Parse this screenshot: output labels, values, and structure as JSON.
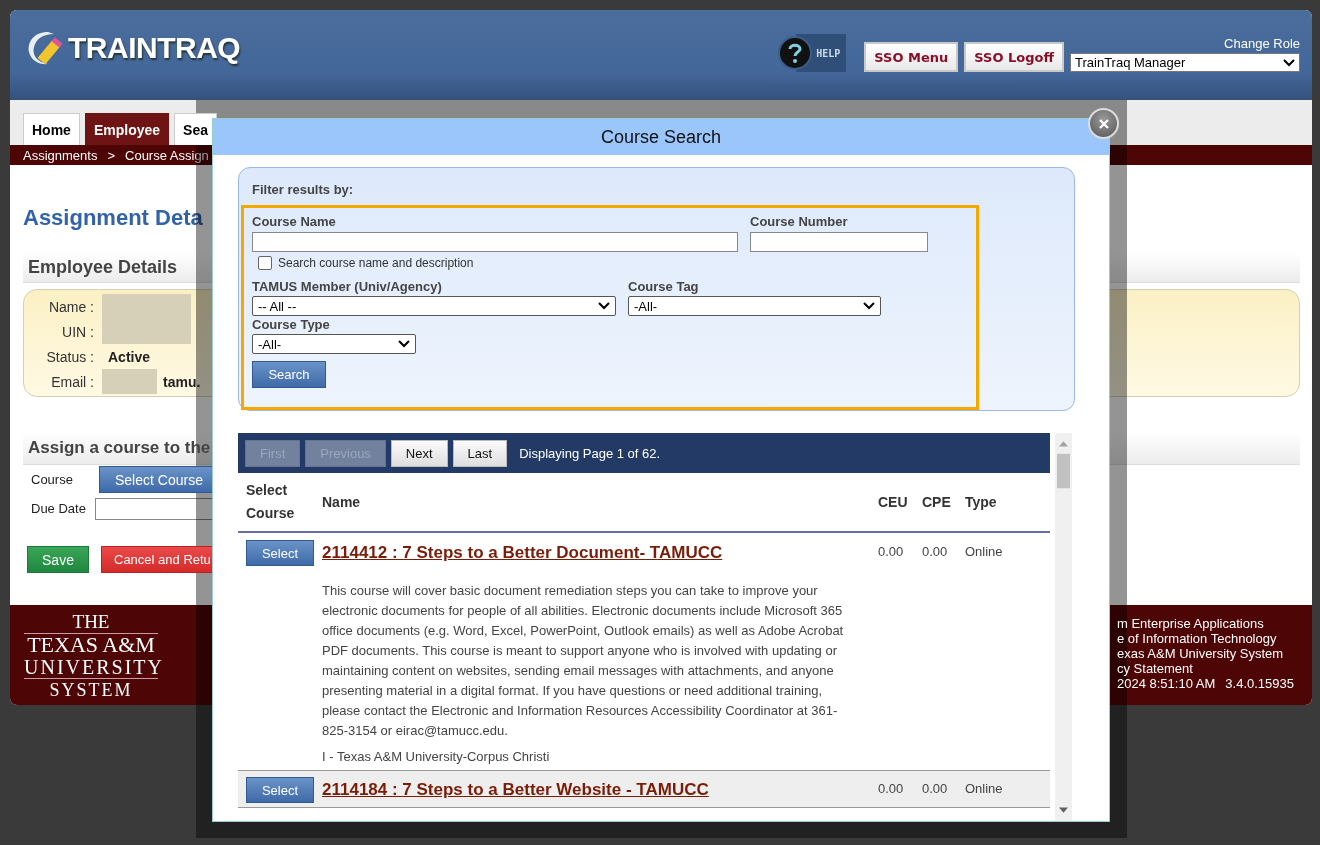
{
  "header": {
    "logo": "TRAINTRAQ",
    "help_label": "HELP",
    "sso_menu": "SSO Menu",
    "sso_logoff": "SSO Logoff",
    "change_role_label": "Change Role",
    "role": "TrainTraq Manager"
  },
  "tabs": [
    {
      "label": "Home",
      "selected": false
    },
    {
      "label": "Employee",
      "selected": true
    },
    {
      "label": "Sea",
      "selected": false
    }
  ],
  "breadcrumb": {
    "items": [
      "Assignments",
      "Course Assign"
    ],
    "separator": ">"
  },
  "page_title": "Assignment Deta",
  "employee_section": {
    "title": "Employee Details",
    "fields": [
      {
        "label": "Name :",
        "kind": "redacted"
      },
      {
        "label": "UIN :",
        "kind": "redacted"
      },
      {
        "label": "Status :",
        "kind": "text",
        "value": "Active"
      },
      {
        "label": "Email :",
        "kind": "redacted_suffix",
        "value": "tamu."
      }
    ]
  },
  "assign_section": {
    "title": "Assign a course to the",
    "course_label": "Course",
    "select_course": "Select Course",
    "due_date_label": "Due Date",
    "save": "Save",
    "cancel": "Cancel and Retu"
  },
  "footer": {
    "logo_lines": [
      "THE",
      "TEXAS A&M",
      "UNIVERSITY",
      "SYSTEM"
    ],
    "lines": [
      "m Enterprise Applications",
      "e of Information Technology",
      "exas A&M University System",
      "cy Statement"
    ],
    "timestamp": "2024 8:51:10 AM",
    "version": "3.4.0.15935"
  },
  "modal": {
    "title": "Course Search",
    "filter": {
      "heading": "Filter results by:",
      "course_name_label": "Course Name",
      "course_number_label": "Course Number",
      "search_description": {
        "label": "Search course name and description",
        "checked": false
      },
      "member_label": "TAMUS Member (Univ/Agency)",
      "member_value": "-- All --",
      "tag_label": "Course Tag",
      "tag_value": "-All-",
      "type_label": "Course Type",
      "type_value": "-All-",
      "search_button": "Search"
    },
    "pager": {
      "buttons": [
        {
          "label": "First",
          "disabled": true
        },
        {
          "label": "Previous",
          "disabled": true
        },
        {
          "label": "Next",
          "disabled": false
        },
        {
          "label": "Last",
          "disabled": false
        }
      ],
      "status": "Displaying Page 1 of 62."
    },
    "table": {
      "columns": [
        "Select Course",
        "Name",
        "CEU",
        "CPE",
        "Type"
      ],
      "rows": [
        {
          "select": "Select",
          "title": "2114412 : 7 Steps to a Better Document- TAMUCC",
          "ceu": "0.00",
          "cpe": "0.00",
          "type": "Online",
          "description": "This course will cover basic document remediation steps you can take to improve your electronic documents for people of all abilities. Electronic documents include Microsoft 365 office documents (e.g. Word, Excel, PowerPoint, Outlook emails) as well as Adobe Acrobat PDF documents. This course is meant to support anyone who is involved with updating or maintaining content on websites, sending email messages with attachments, and anyone presenting material in a digital format. If you have questions or need additional training, please contact the Electronic and Information Resources Accessibility Coordinator at 361-825-3154 or eirac@tamucc.edu.",
          "member": "I - Texas A&M University-Corpus Christi"
        },
        {
          "select": "Select",
          "title": "2114184 : 7 Steps to a Better Website - TAMUCC",
          "ceu": "0.00",
          "cpe": "0.00",
          "type": "Online"
        }
      ]
    }
  }
}
